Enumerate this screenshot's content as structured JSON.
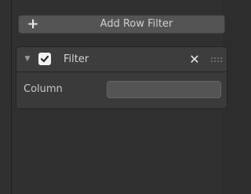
{
  "add_filter_button": {
    "icon": "plus-icon",
    "label": "Add Row Filter"
  },
  "filter": {
    "expanded": true,
    "enabled": true,
    "title": "Filter",
    "column_label": "Column",
    "column_value": ""
  },
  "colors": {
    "background": "#303030",
    "button": "#545454",
    "card": "#3a3a3a",
    "text": "#d0d0d0"
  }
}
